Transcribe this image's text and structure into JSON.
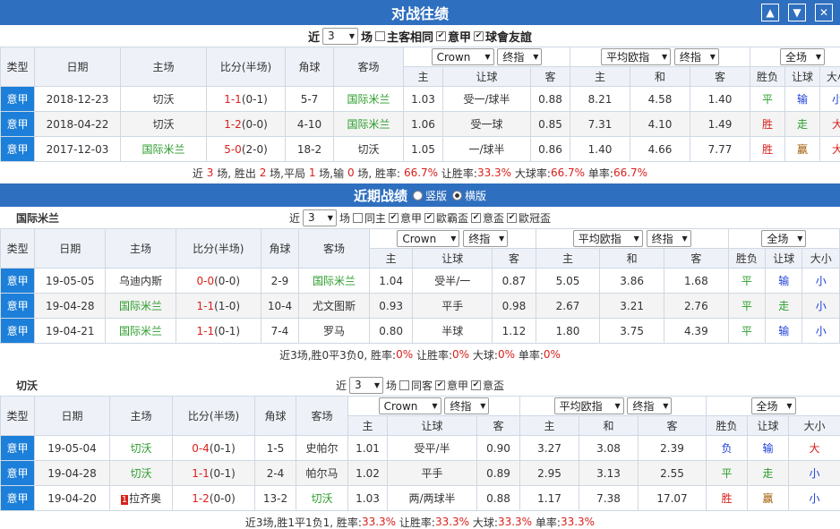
{
  "header": {
    "title": "对战往绩",
    "icons": [
      "arrow-up-icon",
      "arrow-down-icon",
      "close-icon"
    ]
  },
  "h2h": {
    "controls": {
      "prefix": "近",
      "count": "3",
      "suffix": "场",
      "checks": [
        {
          "label": "主客相同",
          "checked": false
        },
        {
          "label": "意甲",
          "checked": true
        },
        {
          "label": "球會友誼",
          "checked": true
        }
      ]
    },
    "cols": {
      "type": "类型",
      "date": "日期",
      "home": "主场",
      "score": "比分(半场)",
      "corner": "角球",
      "away": "客场",
      "company": "Crown",
      "ah_kind": "终指",
      "eu_kind": "平均欧指",
      "eu_kind2": "终指",
      "range": "全场",
      "h": "主",
      "line": "让球",
      "a": "客",
      "w": "主",
      "d": "和",
      "l": "客",
      "res": "胜负",
      "ahres": "让球",
      "ou": "大小"
    },
    "rows": [
      {
        "type": "意甲",
        "date": "2018-12-23",
        "home": "切沃",
        "score": "1-1",
        "half": "(0-1)",
        "corner": "5-7",
        "away": "国际米兰",
        "h": "1.03",
        "line": "受一/球半",
        "a": "0.88",
        "w": "8.21",
        "d": "4.58",
        "l": "1.40",
        "res": "平",
        "ah": "输",
        "ou": "小"
      },
      {
        "type": "意甲",
        "date": "2018-04-22",
        "home": "切沃",
        "score": "1-2",
        "half": "(0-0)",
        "corner": "4-10",
        "away": "国际米兰",
        "h": "1.06",
        "line": "受一球",
        "a": "0.85",
        "w": "7.31",
        "d": "4.10",
        "l": "1.49",
        "res": "胜",
        "ah": "走",
        "ou": "大"
      },
      {
        "type": "意甲",
        "date": "2017-12-03",
        "home": "国际米兰",
        "score": "5-0",
        "half": "(2-0)",
        "corner": "18-2",
        "away": "切沃",
        "h": "1.05",
        "line": "一/球半",
        "a": "0.86",
        "w": "1.40",
        "d": "4.66",
        "l": "7.77",
        "res": "胜",
        "ah": "赢",
        "ou": "大"
      }
    ],
    "summary": {
      "t1": "近",
      "n": "3",
      "t2": "场, 胜出",
      "win": "2",
      "t3": "场,平局",
      "draw": "1",
      "t4": "场,输",
      "loss": "0",
      "t5": "场, 胜率:",
      "winrate": "66.7%",
      "t6": "让胜率:",
      "ahrate": "33.3%",
      "t7": "大球率:",
      "big": "66.7%",
      "t8": "单率:",
      "odd": "66.7%"
    }
  },
  "recent": {
    "title": "近期战绩",
    "opt1": "竖版",
    "opt2": "横版"
  },
  "team1": {
    "name": "国际米兰",
    "controls": {
      "prefix": "近",
      "count": "3",
      "suffix": "场",
      "checks": [
        {
          "label": "同主",
          "checked": false
        },
        {
          "label": "意甲",
          "checked": true
        },
        {
          "label": "歐霸盃",
          "checked": true
        },
        {
          "label": "意盃",
          "checked": true
        },
        {
          "label": "歐冠盃",
          "checked": true
        }
      ]
    },
    "rows": [
      {
        "type": "意甲",
        "date": "19-05-05",
        "home": "乌迪内斯",
        "score": "0-0",
        "half": "(0-0)",
        "corner": "2-9",
        "away": "国际米兰",
        "h": "1.04",
        "line": "受半/一",
        "a": "0.87",
        "w": "5.05",
        "d": "3.86",
        "l": "1.68",
        "res": "平",
        "ah": "输",
        "ou": "小"
      },
      {
        "type": "意甲",
        "date": "19-04-28",
        "home": "国际米兰",
        "score": "1-1",
        "half": "(1-0)",
        "corner": "10-4",
        "away": "尤文图斯",
        "h": "0.93",
        "line": "平手",
        "a": "0.98",
        "w": "2.67",
        "d": "3.21",
        "l": "2.76",
        "res": "平",
        "ah": "走",
        "ou": "小"
      },
      {
        "type": "意甲",
        "date": "19-04-21",
        "home": "国际米兰",
        "score": "1-1",
        "half": "(0-1)",
        "corner": "7-4",
        "away": "罗马",
        "h": "0.80",
        "line": "半球",
        "a": "1.12",
        "w": "1.80",
        "d": "3.75",
        "l": "4.39",
        "res": "平",
        "ah": "输",
        "ou": "小"
      }
    ],
    "summary": {
      "text": "近3场,胜0平3负0, 胜率:",
      "winrate": "0%",
      "t2": "让胜率:",
      "ahrate": "0%",
      "t3": "大球:",
      "big": "0%",
      "t4": "单率:",
      "odd": "0%"
    }
  },
  "team2": {
    "name": "切沃",
    "controls": {
      "prefix": "近",
      "count": "3",
      "suffix": "场",
      "checks": [
        {
          "label": "同客",
          "checked": false
        },
        {
          "label": "意甲",
          "checked": true
        },
        {
          "label": "意盃",
          "checked": true
        }
      ]
    },
    "rows": [
      {
        "type": "意甲",
        "date": "19-05-04",
        "home": "切沃",
        "score": "0-4",
        "half": "(0-1)",
        "corner": "1-5",
        "away": "史帕尔",
        "h": "1.01",
        "line": "受平/半",
        "a": "0.90",
        "w": "3.27",
        "d": "3.08",
        "l": "2.39",
        "res": "负",
        "ah": "输",
        "ou": "大"
      },
      {
        "type": "意甲",
        "date": "19-04-28",
        "home": "切沃",
        "score": "1-1",
        "half": "(0-1)",
        "corner": "2-4",
        "away": "帕尔马",
        "h": "1.02",
        "line": "平手",
        "a": "0.89",
        "w": "2.95",
        "d": "3.13",
        "l": "2.55",
        "res": "平",
        "ah": "走",
        "ou": "小"
      },
      {
        "type": "意甲",
        "date": "19-04-20",
        "tag": "1",
        "home": "拉齐奥",
        "score": "1-2",
        "half": "(0-0)",
        "corner": "13-2",
        "away": "切沃",
        "h": "1.03",
        "line": "两/两球半",
        "a": "0.88",
        "w": "1.17",
        "d": "7.38",
        "l": "17.07",
        "res": "胜",
        "ah": "赢",
        "ou": "小"
      }
    ],
    "summary": {
      "text": "近3场,胜1平1负1, 胜率:",
      "winrate": "33.3%",
      "t2": "让胜率:",
      "ahrate": "33.3%",
      "t3": "大球:",
      "big": "33.3%",
      "t4": "单率:",
      "odd": "33.3%"
    }
  }
}
